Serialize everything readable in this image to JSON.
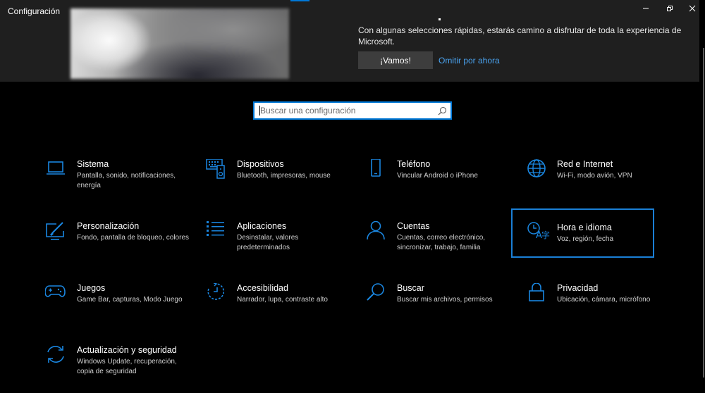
{
  "window": {
    "title": "Configuración"
  },
  "banner": {
    "message": "Con algunas selecciones rápidas, estarás camino a disfrutar de toda la experiencia de Microsoft.",
    "primary_button": "¡Vamos!",
    "skip_link": "Omitir por ahora"
  },
  "search": {
    "placeholder": "Buscar una configuración"
  },
  "colors": {
    "accent": "#0078d7",
    "background": "#000000",
    "banner_background": "#1f1f1f"
  },
  "categories": [
    {
      "title": "Sistema",
      "description": "Pantalla, sonido, notificaciones, energía",
      "icon": "laptop-icon"
    },
    {
      "title": "Dispositivos",
      "description": "Bluetooth, impresoras, mouse",
      "icon": "devices-icon"
    },
    {
      "title": "Teléfono",
      "description": "Vincular Android o iPhone",
      "icon": "phone-icon"
    },
    {
      "title": "Red e Internet",
      "description": "Wi-Fi, modo avión, VPN",
      "icon": "globe-icon"
    },
    {
      "title": "Personalización",
      "description": "Fondo, pantalla de bloqueo, colores",
      "icon": "personalization-icon"
    },
    {
      "title": "Aplicaciones",
      "description": "Desinstalar, valores predeterminados",
      "icon": "apps-list-icon"
    },
    {
      "title": "Cuentas",
      "description": "Cuentas, correo electrónico, sincronizar, trabajo, familia",
      "icon": "person-icon"
    },
    {
      "title": "Hora e idioma",
      "description": "Voz, región, fecha",
      "icon": "time-language-icon"
    },
    {
      "title": "Juegos",
      "description": "Game Bar, capturas, Modo Juego",
      "icon": "gamepad-icon"
    },
    {
      "title": "Accesibilidad",
      "description": "Narrador, lupa, contraste alto",
      "icon": "accessibility-icon"
    },
    {
      "title": "Buscar",
      "description": "Buscar mis archivos, permisos",
      "icon": "search-icon"
    },
    {
      "title": "Privacidad",
      "description": "Ubicación, cámara, micrófono",
      "icon": "lock-icon"
    },
    {
      "title": "Actualización y seguridad",
      "description": "Windows Update, recuperación, copia de seguridad",
      "icon": "update-icon"
    }
  ]
}
